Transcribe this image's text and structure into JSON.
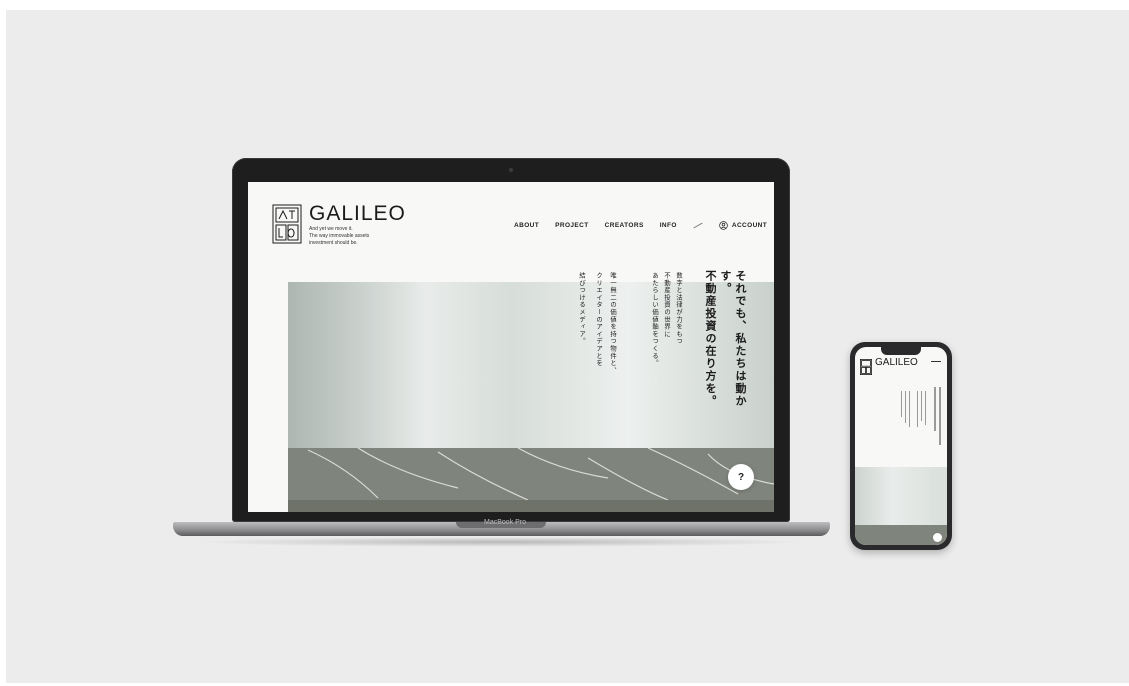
{
  "site": {
    "logo_text": "GALILEO",
    "tagline": [
      "And yet we move it.",
      "The way immovable assets",
      "investment should be."
    ],
    "nav": [
      "ABOUT",
      "PROJECT",
      "CREATORS",
      "INFO"
    ],
    "account": "ACCOUNT",
    "headline": [
      "それでも、私たちは動かす。",
      "不動産投資の在り方を。"
    ],
    "body": [
      "数字と法律が力をもつ",
      "不動産投資の世界に",
      "あたらしい価値軸をつくる。",
      "唯一無二の価値を持つ物件と、",
      "クリエイターのアイデアとを",
      "結びつけるメディア。"
    ],
    "help_label": "?"
  },
  "device": {
    "laptop_label": "MacBook Pro"
  },
  "colors": {
    "background": "#ececec",
    "device_body": "#1e1e1f",
    "page_bg": "#f8f8f7",
    "text": "#1b1b1b"
  },
  "icons": [
    "logo-mark-icon",
    "user-icon",
    "menu-icon",
    "help-icon"
  ]
}
